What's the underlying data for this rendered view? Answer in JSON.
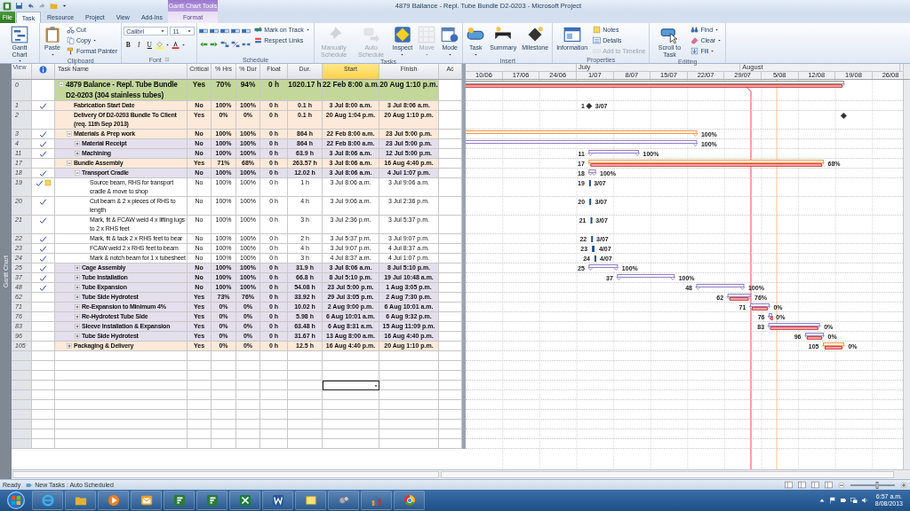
{
  "window": {
    "title": "4879 Ballance - Repl. Tube Bundle D2-0203 - Microsoft Project",
    "context_group": "Gantt Chart Tools"
  },
  "ribbon_tabs": [
    {
      "label": "File",
      "kind": "file",
      "selected": false
    },
    {
      "label": "Task",
      "kind": "tab",
      "selected": true
    },
    {
      "label": "Resource",
      "kind": "tab",
      "selected": false
    },
    {
      "label": "Project",
      "kind": "tab",
      "selected": false
    },
    {
      "label": "View",
      "kind": "tab",
      "selected": false
    },
    {
      "label": "Add-Ins",
      "kind": "tab",
      "selected": false
    },
    {
      "label": "Format",
      "kind": "context",
      "selected": false
    }
  ],
  "ribbon": {
    "groups": [
      {
        "title": "View",
        "items": [
          {
            "kind": "large",
            "label": "Gantt Chart",
            "dropdown": true,
            "disabled": false
          }
        ]
      },
      {
        "title": "Clipboard",
        "items": [
          {
            "kind": "large",
            "label": "Paste",
            "dropdown": true,
            "disabled": false
          },
          {
            "kind": "small",
            "label": "Cut",
            "dropdown": false,
            "disabled": false
          },
          {
            "kind": "small",
            "label": "Copy",
            "dropdown": true,
            "disabled": false
          },
          {
            "kind": "small",
            "label": "Format Painter",
            "dropdown": false,
            "disabled": false
          }
        ]
      },
      {
        "title": "Font",
        "items": [
          {
            "kind": "field",
            "value": "Calibri"
          },
          {
            "kind": "field",
            "value": "11"
          },
          {
            "kind": "format",
            "label": "B"
          },
          {
            "kind": "format",
            "label": "I"
          },
          {
            "kind": "format",
            "label": "U"
          }
        ]
      },
      {
        "title": "Schedule",
        "items": [
          {
            "kind": "small",
            "label": "Mark on Track",
            "dropdown": true,
            "disabled": false
          },
          {
            "kind": "small",
            "label": "Respect Links",
            "dropdown": false,
            "disabled": false
          }
        ]
      },
      {
        "title": "Tasks",
        "items": [
          {
            "kind": "large",
            "label": "Manually Schedule",
            "dropdown": false,
            "disabled": true
          },
          {
            "kind": "large",
            "label": "Auto Schedule",
            "dropdown": false,
            "disabled": true
          },
          {
            "kind": "large",
            "label": "Inspect",
            "dropdown": true,
            "disabled": false
          },
          {
            "kind": "large",
            "label": "Move",
            "dropdown": true,
            "disabled": true
          },
          {
            "kind": "large",
            "label": "Mode",
            "dropdown": true,
            "disabled": false
          }
        ]
      },
      {
        "title": "Insert",
        "items": [
          {
            "kind": "large",
            "label": "Task",
            "dropdown": true,
            "disabled": false
          },
          {
            "kind": "large",
            "label": "Summary",
            "dropdown": false,
            "disabled": false
          },
          {
            "kind": "large",
            "label": "Milestone",
            "dropdown": false,
            "disabled": false
          }
        ]
      },
      {
        "title": "Properties",
        "items": [
          {
            "kind": "large",
            "label": "Information",
            "dropdown": false,
            "disabled": false
          },
          {
            "kind": "small",
            "label": "Notes",
            "dropdown": false,
            "disabled": false
          },
          {
            "kind": "small",
            "label": "Details",
            "dropdown": false,
            "disabled": false
          },
          {
            "kind": "small",
            "label": "Add to Timeline",
            "dropdown": false,
            "disabled": true
          }
        ]
      },
      {
        "title": "Editing",
        "items": [
          {
            "kind": "large",
            "label": "Scroll to Task",
            "dropdown": false,
            "disabled": false
          },
          {
            "kind": "small",
            "label": "Find",
            "dropdown": true,
            "disabled": false
          },
          {
            "kind": "small",
            "label": "Clear",
            "dropdown": true,
            "disabled": false
          },
          {
            "kind": "small",
            "label": "Fill",
            "dropdown": true,
            "disabled": false
          }
        ]
      }
    ]
  },
  "view_bar": {
    "label": "Gantt Chart"
  },
  "sheet": {
    "columns": [
      {
        "label": "Task Name",
        "selected": false
      },
      {
        "label": "Critical",
        "selected": false
      },
      {
        "label": "% Hrs",
        "selected": false
      },
      {
        "label": "% Dur",
        "selected": false
      },
      {
        "label": "Float",
        "selected": false
      },
      {
        "label": "Dur.",
        "selected": false
      },
      {
        "label": "Start",
        "selected": true
      },
      {
        "label": "Finish",
        "selected": false
      },
      {
        "label": "Ac",
        "selected": false
      }
    ],
    "timeline": {
      "months": [
        {
          "label": "July"
        },
        {
          "label": "August"
        }
      ],
      "weeks": [
        "10/06",
        "17/06",
        "24/06",
        "1/07",
        "8/07",
        "15/07",
        "22/07",
        "29/07",
        "5/08",
        "12/08",
        "19/08",
        "26/08"
      ]
    },
    "tasks": [
      {
        "row_number": "0",
        "kind": "summary",
        "expanded": true,
        "complete": false,
        "note": false,
        "critical_path": true,
        "color": "#c4d79b",
        "name": "4879 Balance - Repl. Tube Bundle D2-0203 (304 stainless tubes)",
        "critical": "Yes",
        "pct_hrs": "70%",
        "pct_dur": "94%",
        "float": "0 h",
        "duration": "1020.17 h",
        "start": "22 Feb 8:00 a.m.",
        "finish": "20 Aug 1:10 p.m.",
        "children": [
          {
            "row_number": "1",
            "kind": "milestone",
            "complete": true,
            "note": false,
            "critical_path": false,
            "color": "#fde9d9",
            "name": "Fabrication Start Date",
            "critical": "No",
            "pct_hrs": "100%",
            "pct_dur": "100%",
            "float": "0 h",
            "duration": "0.1 h",
            "start": "3 Jul 8:00 a.m.",
            "finish": "3 Jul 8:06 a.m.",
            "gantt": {
              "id_label": "1",
              "label": "3/07"
            }
          },
          {
            "row_number": "2",
            "kind": "milestone",
            "complete": false,
            "note": false,
            "critical_path": false,
            "color": "#fde9d9",
            "name": "Delivery Of D2-0203 Bundle To Client (req. 11th Sep 2013)",
            "critical": "Yes",
            "pct_hrs": "0%",
            "pct_dur": "0%",
            "float": "0 h",
            "duration": "0.1 h",
            "start": "20 Aug 1:04 p.m.",
            "finish": "20 Aug 1:10 p.m."
          },
          {
            "row_number": "3",
            "kind": "summary",
            "expanded": true,
            "complete": true,
            "note": false,
            "critical_path": false,
            "color": "#fde9d9",
            "name": "Materials & Prep work",
            "critical": "No",
            "pct_hrs": "100%",
            "pct_dur": "100%",
            "float": "0 h",
            "duration": "864 h",
            "start": "22 Feb 8:00 a.m.",
            "finish": "23 Jul 5:00 p.m.",
            "gantt": {
              "label": "100%"
            },
            "children": [
              {
                "row_number": "4",
                "kind": "summary",
                "expanded": false,
                "complete": true,
                "note": false,
                "critical_path": false,
                "color": "#e4dfec",
                "name": "Material Receipt",
                "critical": "No",
                "pct_hrs": "100%",
                "pct_dur": "100%",
                "float": "0 h",
                "duration": "864 h",
                "start": "22 Feb 8:00 a.m.",
                "finish": "23 Jul 5:00 p.m.",
                "gantt": {
                  "label": "100%"
                }
              },
              {
                "row_number": "11",
                "kind": "summary",
                "expanded": false,
                "complete": true,
                "note": false,
                "critical_path": false,
                "color": "#e4dfec",
                "name": "Machining",
                "critical": "No",
                "pct_hrs": "100%",
                "pct_dur": "100%",
                "float": "0 h",
                "duration": "63.9 h",
                "start": "3 Jul 8:06 a.m.",
                "finish": "12 Jul 5:00 p.m.",
                "gantt": {
                  "id_label": "11",
                  "label": "100%"
                }
              }
            ]
          },
          {
            "row_number": "17",
            "kind": "summary",
            "expanded": true,
            "complete": false,
            "note": false,
            "critical_path": true,
            "color": "#fde9d9",
            "name": "Bundle Assembly",
            "critical": "Yes",
            "pct_hrs": "71%",
            "pct_dur": "68%",
            "float": "0 h",
            "duration": "263.57 h",
            "start": "3 Jul 8:06 a.m.",
            "finish": "16 Aug 4:40 p.m.",
            "gantt": {
              "id_label": "17",
              "label": "68%"
            },
            "children": [
              {
                "row_number": "18",
                "kind": "summary",
                "expanded": true,
                "complete": true,
                "note": false,
                "critical_path": false,
                "color": "#e4dfec",
                "name": "Transport Cradle",
                "critical": "No",
                "pct_hrs": "100%",
                "pct_dur": "100%",
                "float": "0 h",
                "duration": "12.02 h",
                "start": "3 Jul 8:06 a.m.",
                "finish": "4 Jul 1:07 p.m.",
                "gantt": {
                  "id_label": "18",
                  "label": "100%"
                },
                "children": [
                  {
                    "row_number": "19",
                    "kind": "task",
                    "complete": true,
                    "note": true,
                    "critical_path": false,
                    "color": "#ffffff",
                    "name": "Source beam, RHS for transport cradle & move to shop",
                    "critical": "No",
                    "pct_hrs": "100%",
                    "pct_dur": "100%",
                    "float": "0 h",
                    "duration": "1 h",
                    "start": "3 Jul 8:06 a.m.",
                    "finish": "3 Jul 9:06 a.m.",
                    "gantt": {
                      "id_label": "19",
                      "label": "3/07"
                    }
                  },
                  {
                    "row_number": "20",
                    "kind": "task",
                    "complete": true,
                    "note": false,
                    "critical_path": false,
                    "color": "#ffffff",
                    "name": "Cut beam & 2 x pieces of RHS to length",
                    "critical": "No",
                    "pct_hrs": "100%",
                    "pct_dur": "100%",
                    "float": "0 h",
                    "duration": "4 h",
                    "start": "3 Jul 9:06 a.m.",
                    "finish": "3 Jul 2:36 p.m.",
                    "gantt": {
                      "id_label": "20",
                      "label": "3/07"
                    }
                  },
                  {
                    "row_number": "21",
                    "kind": "task",
                    "complete": true,
                    "note": false,
                    "critical_path": false,
                    "color": "#ffffff",
                    "name": "Mark, fit & FCAW weld 4 x lifting lugs to 2 x RHS feet",
                    "critical": "No",
                    "pct_hrs": "100%",
                    "pct_dur": "100%",
                    "float": "0 h",
                    "duration": "3 h",
                    "start": "3 Jul 2:36 p.m.",
                    "finish": "3 Jul 5:37 p.m.",
                    "gantt": {
                      "id_label": "21",
                      "label": "3/07"
                    }
                  },
                  {
                    "row_number": "22",
                    "kind": "task",
                    "complete": true,
                    "note": false,
                    "critical_path": false,
                    "color": "#ffffff",
                    "name": "Mark, fit & tack 2 x RHS feet to bear",
                    "critical": "No",
                    "pct_hrs": "100%",
                    "pct_dur": "100%",
                    "float": "0 h",
                    "duration": "2 h",
                    "start": "3 Jul 5:37 p.m.",
                    "finish": "3 Jul 9:07 p.m.",
                    "gantt": {
                      "id_label": "22",
                      "label": "3/07"
                    }
                  },
                  {
                    "row_number": "23",
                    "kind": "task",
                    "complete": true,
                    "note": false,
                    "critical_path": false,
                    "color": "#ffffff",
                    "name": "FCAW weld 2 x RHS feet to beam",
                    "critical": "No",
                    "pct_hrs": "100%",
                    "pct_dur": "100%",
                    "float": "0 h",
                    "duration": "4 h",
                    "start": "3 Jul 9:07 p.m.",
                    "finish": "4 Jul 8:37 a.m.",
                    "gantt": {
                      "id_label": "23",
                      "label": "4/07"
                    }
                  },
                  {
                    "row_number": "24",
                    "kind": "task",
                    "complete": true,
                    "note": false,
                    "critical_path": false,
                    "color": "#ffffff",
                    "name": "Mark & notch beam for 1 x tubesheet",
                    "critical": "No",
                    "pct_hrs": "100%",
                    "pct_dur": "100%",
                    "float": "0 h",
                    "duration": "3 h",
                    "start": "4 Jul 8:37 a.m.",
                    "finish": "4 Jul 1:07 p.m.",
                    "gantt": {
                      "id_label": "24",
                      "label": "4/07"
                    }
                  }
                ]
              },
              {
                "row_number": "25",
                "kind": "summary",
                "expanded": false,
                "complete": true,
                "note": false,
                "critical_path": false,
                "color": "#e4dfec",
                "name": "Cage Assembly",
                "critical": "No",
                "pct_hrs": "100%",
                "pct_dur": "100%",
                "float": "0 h",
                "duration": "31.9 h",
                "start": "3 Jul 8:06 a.m.",
                "finish": "8 Jul 5:10 p.m.",
                "gantt": {
                  "id_label": "25",
                  "label": "100%"
                }
              },
              {
                "row_number": "37",
                "kind": "summary",
                "expanded": false,
                "complete": true,
                "note": false,
                "critical_path": false,
                "color": "#e4dfec",
                "name": "Tube Installation",
                "critical": "No",
                "pct_hrs": "100%",
                "pct_dur": "100%",
                "float": "0 h",
                "duration": "66.8 h",
                "start": "8 Jul 5:10 p.m.",
                "finish": "19 Jul 10:48 a.m.",
                "gantt": {
                  "id_label": "37",
                  "label": "100%"
                }
              },
              {
                "row_number": "48",
                "kind": "summary",
                "expanded": false,
                "complete": true,
                "note": false,
                "critical_path": false,
                "color": "#e4dfec",
                "name": "Tube Expansion",
                "critical": "No",
                "pct_hrs": "100%",
                "pct_dur": "100%",
                "float": "0 h",
                "duration": "54.08 h",
                "start": "23 Jul 5:00 p.m.",
                "finish": "1 Aug 3:05 p.m.",
                "gantt": {
                  "id_label": "48",
                  "label": "100%"
                }
              },
              {
                "row_number": "62",
                "kind": "summary",
                "expanded": false,
                "complete": false,
                "note": false,
                "critical_path": true,
                "color": "#e4dfec",
                "name": "Tube Side Hydrotest",
                "critical": "Yes",
                "pct_hrs": "73%",
                "pct_dur": "76%",
                "float": "0 h",
                "duration": "33.92 h",
                "start": "29 Jul 3:05 p.m.",
                "finish": "2 Aug 7:30 p.m.",
                "gantt": {
                  "id_label": "62",
                  "label": "76%"
                }
              },
              {
                "row_number": "71",
                "kind": "summary",
                "expanded": false,
                "complete": false,
                "note": false,
                "critical_path": true,
                "color": "#e4dfec",
                "name": "Re-Expansion to Minimum 4%",
                "critical": "Yes",
                "pct_hrs": "0%",
                "pct_dur": "0%",
                "float": "0 h",
                "duration": "10.02 h",
                "start": "2 Aug 9:00 p.m.",
                "finish": "6 Aug 10:01 a.m.",
                "gantt": {
                  "id_label": "71",
                  "label": "0%"
                }
              },
              {
                "row_number": "76",
                "kind": "summary",
                "expanded": false,
                "complete": false,
                "note": false,
                "critical_path": true,
                "color": "#e4dfec",
                "name": "Re-Hydrotest Tube Side",
                "critical": "Yes",
                "pct_hrs": "0%",
                "pct_dur": "0%",
                "float": "0 h",
                "duration": "5.98 h",
                "start": "6 Aug 10:01 a.m.",
                "finish": "6 Aug 9:32 p.m.",
                "gantt": {
                  "id_label": "76",
                  "label": "0%"
                }
              },
              {
                "row_number": "83",
                "kind": "summary",
                "expanded": false,
                "complete": false,
                "note": false,
                "critical_path": true,
                "color": "#e4dfec",
                "name": "Sleeve Installation & Expansion",
                "critical": "Yes",
                "pct_hrs": "0%",
                "pct_dur": "0%",
                "float": "0 h",
                "duration": "63.48 h",
                "start": "6 Aug 8:31 a.m.",
                "finish": "15 Aug 11:09 p.m.",
                "gantt": {
                  "id_label": "83",
                  "label": "0%"
                }
              },
              {
                "row_number": "96",
                "kind": "summary",
                "expanded": false,
                "complete": false,
                "note": false,
                "critical_path": true,
                "color": "#e4dfec",
                "name": "Tube Side Hydrotest",
                "critical": "Yes",
                "pct_hrs": "0%",
                "pct_dur": "0%",
                "float": "0 h",
                "duration": "31.67 h",
                "start": "13 Aug 8:00 a.m.",
                "finish": "16 Aug 4:40 p.m.",
                "gantt": {
                  "id_label": "96",
                  "label": "0%"
                }
              }
            ]
          },
          {
            "row_number": "105",
            "kind": "summary",
            "expanded": false,
            "complete": false,
            "note": false,
            "critical_path": true,
            "color": "#fde9d9",
            "name": "Packaging & Delivery",
            "critical": "Yes",
            "pct_hrs": "0%",
            "pct_dur": "0%",
            "float": "0 h",
            "duration": "12.5 h",
            "start": "16 Aug 4:40 p.m.",
            "finish": "20 Aug 1:10 p.m.",
            "gantt": {
              "id_label": "105",
              "label": "0%"
            }
          }
        ]
      }
    ],
    "empty_rows": [
      {
        "selected": false
      },
      {
        "selected": false
      },
      {
        "selected": false
      },
      {
        "selected": true
      },
      {
        "selected": false
      },
      {
        "selected": false
      },
      {
        "selected": false
      },
      {
        "selected": false
      },
      {
        "selected": false
      },
      {
        "selected": false
      }
    ]
  },
  "status_bar": {
    "mode": "Ready",
    "new_tasks": "New Tasks : Auto Scheduled",
    "zoom": {
      "level": 0.6
    }
  },
  "taskbar": {
    "time": "6:57 a.m.",
    "date": "8/08/2013"
  }
}
